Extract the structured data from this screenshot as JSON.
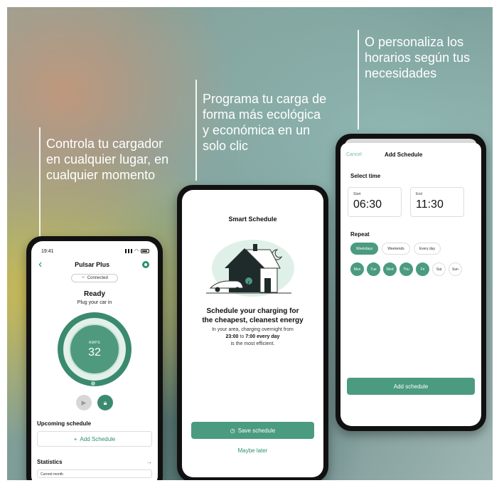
{
  "captions": {
    "left": [
      "Controla tu cargador",
      "en cualquier lugar, en",
      "cualquier momento"
    ],
    "middle": [
      "Programa tu carga de",
      "forma más ecológica",
      "y económica en un",
      "solo clic"
    ],
    "right": [
      "O personaliza los",
      "horarios según tus",
      "necesidades"
    ]
  },
  "phone1": {
    "time": "19:41",
    "title": "Pulsar Plus",
    "connection": "Connected",
    "status": "Ready",
    "substatus": "Plug your car in",
    "amps_label": "AMPS",
    "amps_value": "32",
    "upcoming_label": "Upcoming schedule",
    "add_schedule": "Add Schedule",
    "statistics_label": "Statistics",
    "current_month": "Current month"
  },
  "phone2": {
    "title": "Smart Schedule",
    "heading_line1": "Schedule your charging for",
    "heading_line2": "the cheapest, cleanest energy",
    "body_line1": "In your area, charging overnight from",
    "body_time_from": "23:00",
    "body_to": "to",
    "body_time_to": "7:00 every day",
    "body_line3": "is the most efficient.",
    "save_label": "Save schedule",
    "maybe_label": "Maybe later"
  },
  "phone3": {
    "cancel": "Cancel",
    "title": "Add Schedule",
    "select_time": "Select time",
    "start_label": "Start",
    "start_value": "06:30",
    "end_label": "End",
    "end_value": "11:30",
    "repeat_label": "Repeat",
    "presets": [
      {
        "label": "Weekdays",
        "selected": true
      },
      {
        "label": "Weekends",
        "selected": false
      },
      {
        "label": "Every day",
        "selected": false
      }
    ],
    "days": [
      {
        "label": "Mon",
        "selected": true
      },
      {
        "label": "Tue",
        "selected": true
      },
      {
        "label": "Wed",
        "selected": true
      },
      {
        "label": "Thu",
        "selected": true
      },
      {
        "label": "Fri",
        "selected": true
      },
      {
        "label": "Sat",
        "selected": false
      },
      {
        "label": "Sun",
        "selected": false
      }
    ],
    "add_label": "Add schedule"
  },
  "colors": {
    "accent": "#4a9b7f",
    "accent_dark": "#2a8f73",
    "accent_light": "#e3f1ea"
  }
}
